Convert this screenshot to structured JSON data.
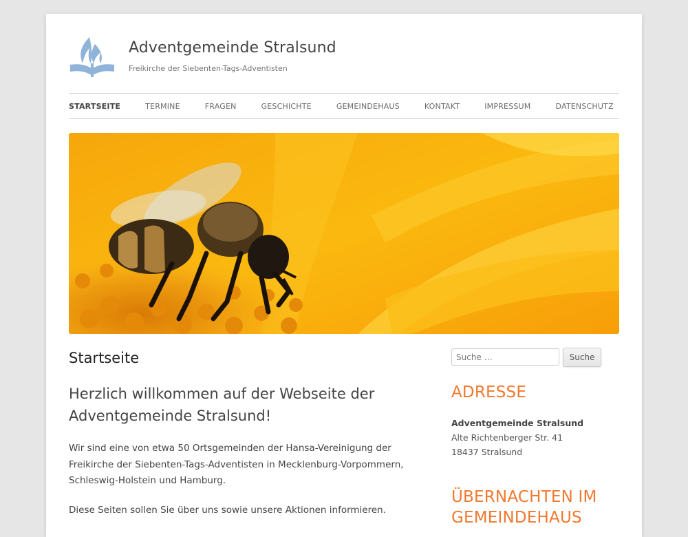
{
  "header": {
    "site_title": "Adventgemeinde Stralsund",
    "site_description": "Freikirche der Siebenten-Tags-Adventisten",
    "logo_icon": "adventist-flame-book-logo",
    "logo_color": "#8fb3d9"
  },
  "nav": {
    "items": [
      {
        "label": "STARTSEITE",
        "current": true
      },
      {
        "label": "TERMINE"
      },
      {
        "label": "FRAGEN"
      },
      {
        "label": "GESCHICHTE"
      },
      {
        "label": "GEMEINDEHAUS"
      },
      {
        "label": "KONTAKT"
      },
      {
        "label": "IMPRESSUM"
      },
      {
        "label": "DATENSCHUTZ"
      }
    ]
  },
  "banner": {
    "icon": "bee-on-sunflower-photo"
  },
  "main": {
    "title": "Startseite",
    "welcome": "Herzlich willkommen auf der Webseite der Adventgemeinde Stralsund!",
    "paragraphs": [
      "Wir sind eine von etwa 50 Ortsgemeinden der Hansa-Vereinigung der Freikirche der Siebenten-Tags-Adventisten in Mecklenburg-Vorpommern, Schleswig-Holstein und Hamburg.",
      "Diese Seiten sollen Sie über uns sowie unsere Aktionen informieren."
    ]
  },
  "sidebar": {
    "search_placeholder": "Suche …",
    "search_button": "Suche",
    "address_title": "ADRESSE",
    "address_name": "Adventgemeinde Stralsund",
    "address_street": "Alte Richtenberger Str. 41",
    "address_city": "18437 Stralsund",
    "overnight_title": "ÜBERNACHTEN IM GEMEINDEHAUS",
    "accent_color": "#f1782f"
  }
}
